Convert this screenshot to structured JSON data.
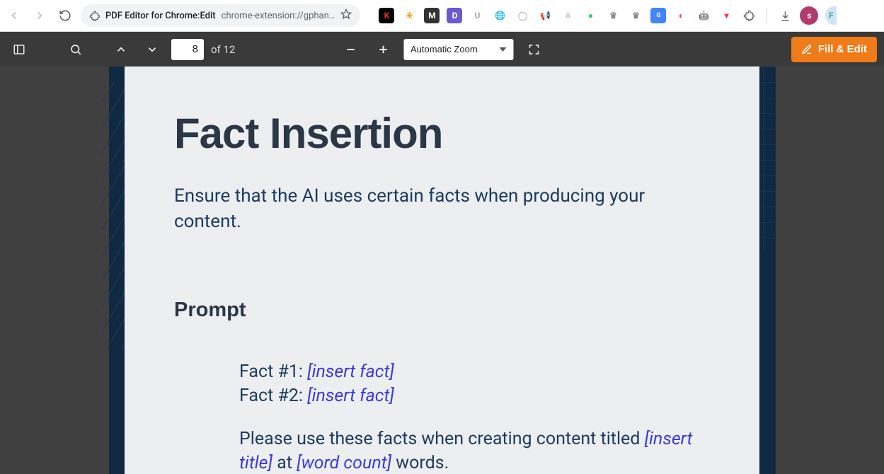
{
  "browser": {
    "page_title": "PDF Editor for Chrome:Edit",
    "url_display": "chrome-extension://gphan…",
    "avatar_letter": "s",
    "half_avatar_letter": "F"
  },
  "toolbar": {
    "page_current": "8",
    "page_total_label": "of 12",
    "zoom_label": "Automatic Zoom",
    "fill_edit_label": "Fill & Edit"
  },
  "doc": {
    "title": "Fact Insertion",
    "subtitle": "Ensure that the AI uses certain facts when producing your content.",
    "prompt_heading": "Prompt",
    "fact1_label": "Fact #1: ",
    "fact1_ph": "[insert fact]",
    "fact2_label": "Fact #2:  ",
    "fact2_ph": "[insert fact]",
    "body1": "Please use these facts when creating content titled ",
    "title_ph": "[insert title]",
    "at_word": " at ",
    "wc_ph": "[word count]",
    "words_tail": " words."
  }
}
